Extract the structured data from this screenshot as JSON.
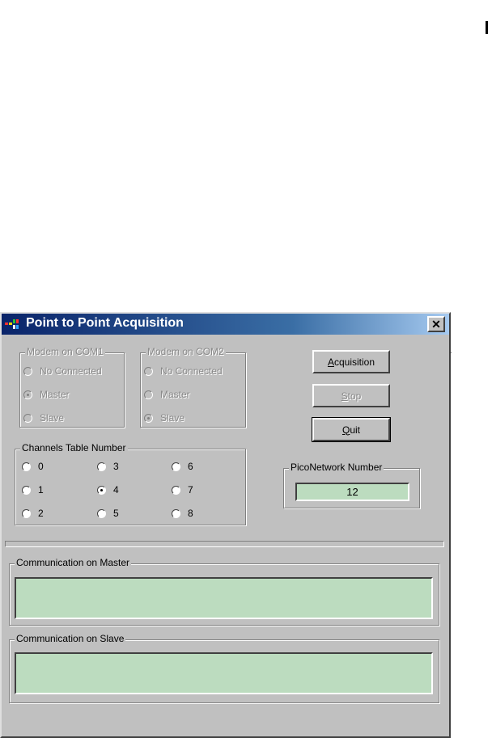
{
  "window": {
    "title": "Point to Point Acquisition",
    "close_label": "✕"
  },
  "modem_com1": {
    "label": "Modem on COM1",
    "options": [
      {
        "label": "No Connected",
        "checked": false
      },
      {
        "label": "Master",
        "checked": true
      },
      {
        "label": "Slave",
        "checked": false
      }
    ]
  },
  "modem_com2": {
    "label": "Modem on COM2",
    "options": [
      {
        "label": "No Connected",
        "checked": false
      },
      {
        "label": "Master",
        "checked": false
      },
      {
        "label": "Slave",
        "checked": true
      }
    ]
  },
  "channels": {
    "label": "Channels Table Number",
    "options": [
      "0",
      "1",
      "2",
      "3",
      "4",
      "5",
      "6",
      "7",
      "8"
    ],
    "selected": "4"
  },
  "buttons": {
    "acquisition": "Acquisition",
    "stop": "Stop",
    "quit": "Quit"
  },
  "pico_network": {
    "label": "PicoNetwork Number",
    "value": "12"
  },
  "comm_master": {
    "label": "Communication  on Master",
    "value": ""
  },
  "comm_slave": {
    "label": "Communication on Slave",
    "value": ""
  },
  "colors": {
    "field_bg": "#bcdcbf",
    "title_start": "#0a246a",
    "title_end": "#a6caf0",
    "dialog_bg": "#c0c0c0"
  }
}
